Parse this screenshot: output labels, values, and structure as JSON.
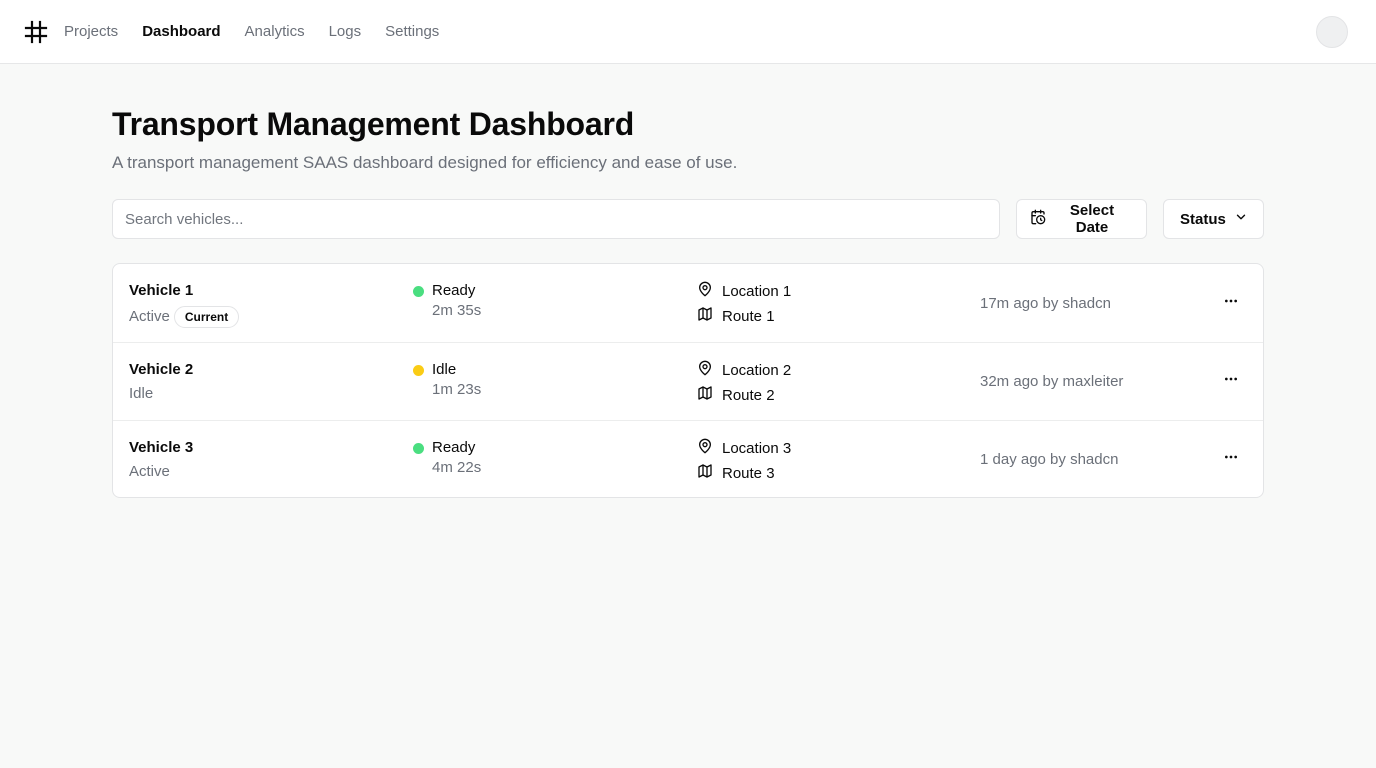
{
  "nav": {
    "items": [
      {
        "label": "Projects",
        "active": false
      },
      {
        "label": "Dashboard",
        "active": true
      },
      {
        "label": "Analytics",
        "active": false
      },
      {
        "label": "Logs",
        "active": false
      },
      {
        "label": "Settings",
        "active": false
      }
    ]
  },
  "page": {
    "title": "Transport Management Dashboard",
    "subtitle": "A transport management SAAS dashboard designed for efficiency and ease of use."
  },
  "toolbar": {
    "search_placeholder": "Search vehicles...",
    "search_value": "",
    "date_label": "Select Date",
    "status_label": "Status"
  },
  "colors": {
    "ready": "#4ade80",
    "idle": "#facc15"
  },
  "vehicles": [
    {
      "name": "Vehicle 1",
      "state": "Active",
      "badge": "Current",
      "status": "Ready",
      "status_color": "ready",
      "duration": "2m 35s",
      "location": "Location 1",
      "route": "Route 1",
      "meta": "17m ago by shadcn"
    },
    {
      "name": "Vehicle 2",
      "state": "Idle",
      "badge": "",
      "status": "Idle",
      "status_color": "idle",
      "duration": "1m 23s",
      "location": "Location 2",
      "route": "Route 2",
      "meta": "32m ago by maxleiter"
    },
    {
      "name": "Vehicle 3",
      "state": "Active",
      "badge": "",
      "status": "Ready",
      "status_color": "ready",
      "duration": "4m 22s",
      "location": "Location 3",
      "route": "Route 3",
      "meta": "1 day ago by shadcn"
    }
  ]
}
